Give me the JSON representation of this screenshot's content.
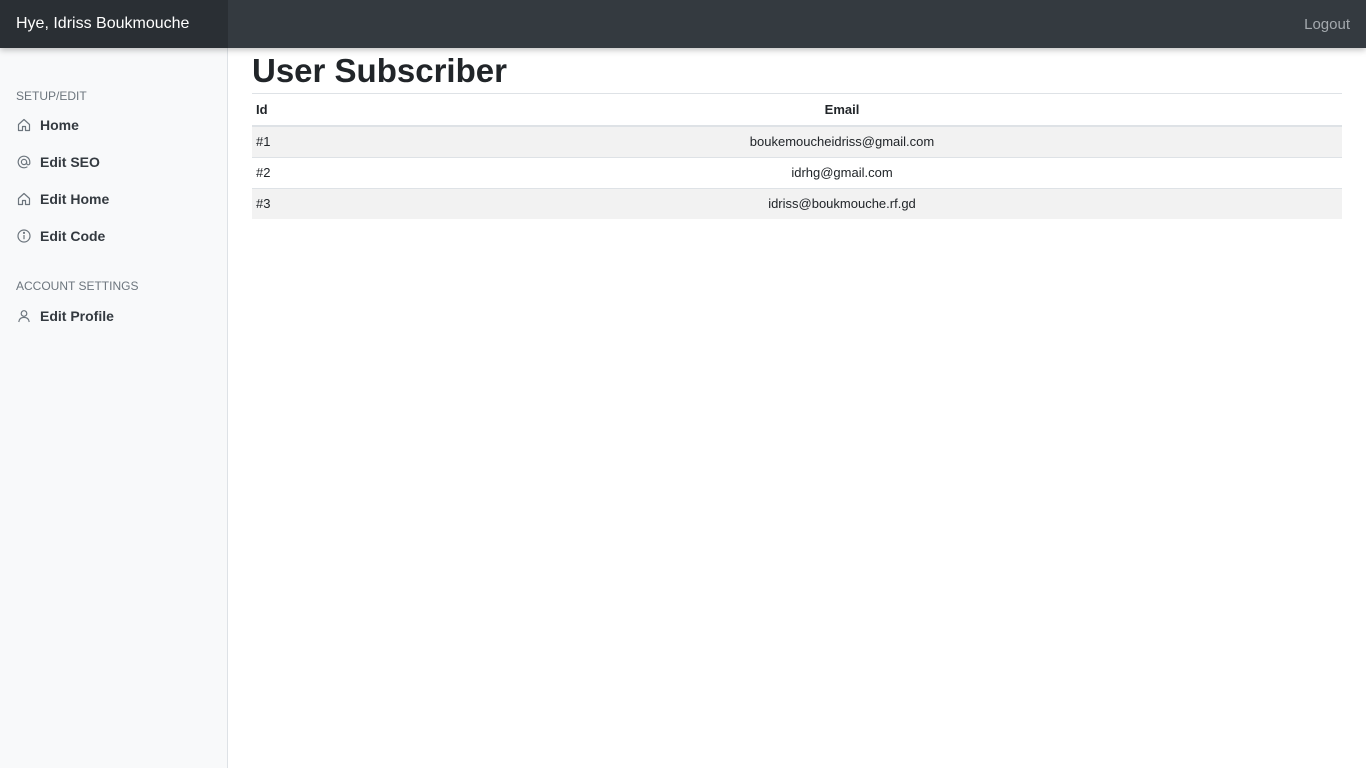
{
  "header": {
    "brand": "Hye, Idriss Boukmouche",
    "logout": "Logout"
  },
  "sidebar": {
    "sections": [
      {
        "heading": "SETUP/EDIT",
        "items": [
          {
            "label": "Home",
            "icon": "home-icon"
          },
          {
            "label": "Edit SEO",
            "icon": "at-icon"
          },
          {
            "label": "Edit Home",
            "icon": "home-icon"
          },
          {
            "label": "Edit Code",
            "icon": "info-icon"
          }
        ]
      },
      {
        "heading": "ACCOUNT SETTINGS",
        "items": [
          {
            "label": "Edit Profile",
            "icon": "user-icon"
          }
        ]
      }
    ]
  },
  "main": {
    "title": "User Subscriber",
    "table": {
      "columns": [
        "Id",
        "Email"
      ],
      "rows": [
        {
          "id": "#1",
          "email": "boukemoucheidriss@gmail.com"
        },
        {
          "id": "#2",
          "email": "idrhg@gmail.com"
        },
        {
          "id": "#3",
          "email": "idriss@boukmouche.rf.gd"
        }
      ]
    }
  },
  "colors": {
    "navbar": "#343a40",
    "brand_bg": "#2a2f34",
    "sidebar_bg": "#f8f9fa",
    "striped_row": "#f2f2f2"
  }
}
